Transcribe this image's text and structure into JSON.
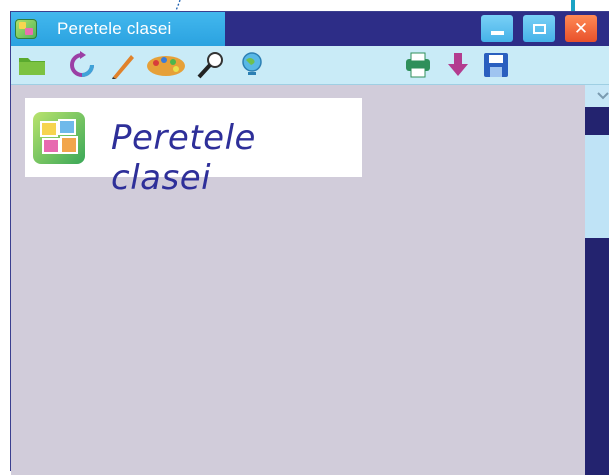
{
  "window": {
    "title": "Peretele clasei"
  },
  "toolbar": {
    "icons": [
      "folder-icon",
      "refresh-icon",
      "pencil-icon",
      "palette-icon",
      "magnifier-icon",
      "globe-icon",
      "printer-icon",
      "download-icon",
      "save-icon"
    ]
  },
  "canvas": {
    "logo_text": "Peretele clasei"
  },
  "colors": {
    "titlebar": "#2d2d87",
    "title_tab": "#2aa2e0",
    "toolbar": "#c9ebf7",
    "canvas": "#d1ccda",
    "logo_text": "#2e2f99",
    "close_button": "#e8502b"
  }
}
